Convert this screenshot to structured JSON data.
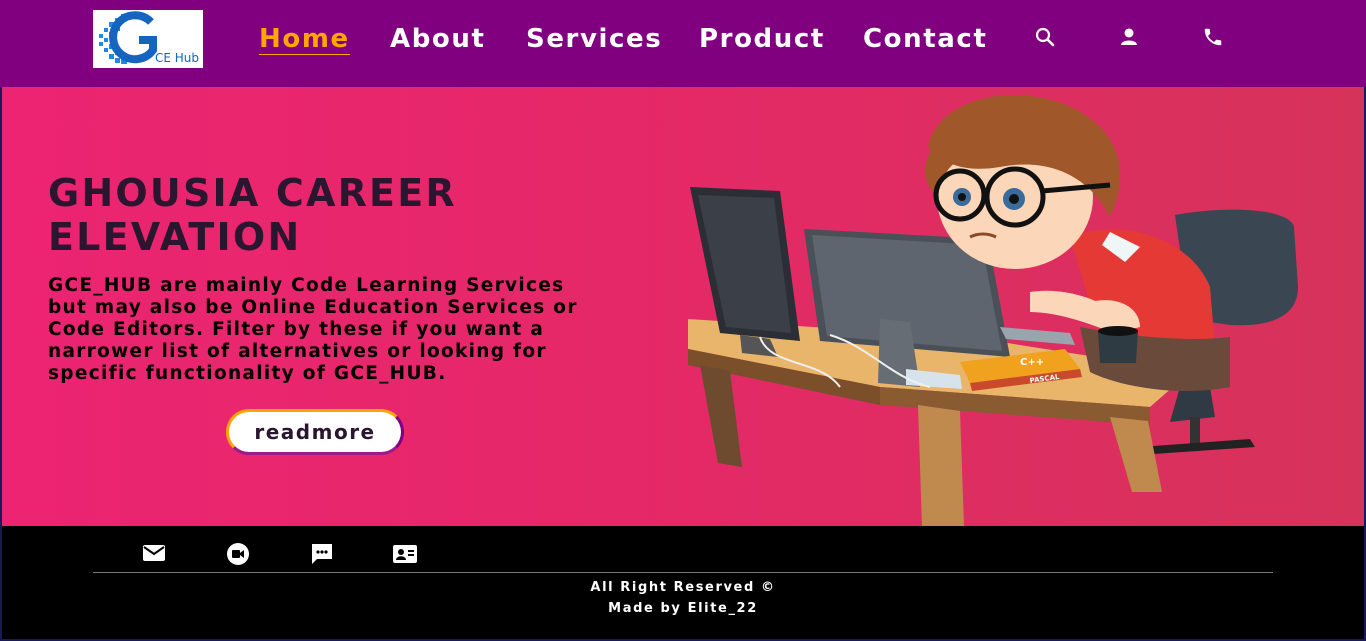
{
  "logo": {
    "text": "CE Hub",
    "mark": "G"
  },
  "nav": {
    "links": [
      "Home",
      "About",
      "Services",
      "Product",
      "Contact"
    ],
    "active": "Home",
    "icons": [
      "search-icon",
      "person-icon",
      "phone-icon"
    ]
  },
  "hero": {
    "title": "GHOUSIA CAREER ELEVATION",
    "description": "GCE_HUB are mainly Code Learning Services but may also be Online Education Services or Code Editors. Filter by these if you want a narrower list of alternatives or looking for specific functionality of GCE_HUB.",
    "button": "readmore",
    "book_top": "C++",
    "book_bottom": "PASCAL"
  },
  "footer": {
    "icons": [
      "mail-icon",
      "video-call-icon",
      "chat-icon",
      "contact-card-icon"
    ],
    "copyright": "All Right Reserved ©",
    "credit": "Made by Elite_22"
  },
  "colors": {
    "nav_bg": "#800080",
    "accent": "#ffa500",
    "hero_start": "#ec2472",
    "hero_end": "#d6335a",
    "footer_bg": "#000000"
  }
}
